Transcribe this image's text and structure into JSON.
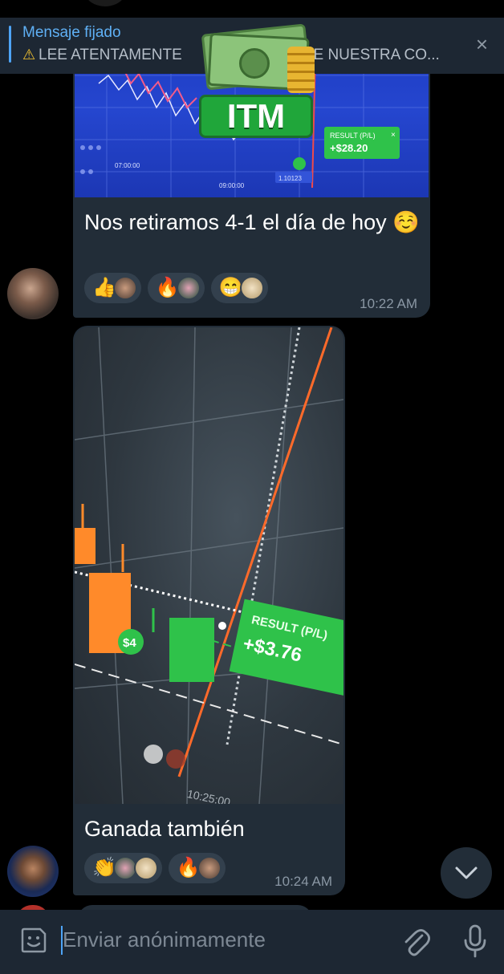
{
  "pinned": {
    "title": "Mensaje fijado",
    "text_left": "LEE ATENTAMENTE",
    "text_right": "DE NUESTRA CO...",
    "close_label": "×"
  },
  "sticker": {
    "label": "ITM"
  },
  "messages": [
    {
      "photo": {
        "result_label": "RESULT (P/L)",
        "result_value": "+$28.20",
        "price_label": "1.10123",
        "time_labels": [
          "07:00:00",
          "09:00:00"
        ]
      },
      "caption": "Nos retiramos 4-1 el día de hoy ☺️",
      "reactions": [
        {
          "emoji": "👍",
          "avatars": 1
        },
        {
          "emoji": "🔥",
          "avatars": 1
        },
        {
          "emoji": "😁",
          "avatars": 1
        }
      ],
      "time": "10:22 AM"
    },
    {
      "photo": {
        "result_label": "RESULT (P/L)",
        "result_value": "+$3.76",
        "stake_label": "$4",
        "time_label": "10:25:00"
      },
      "caption": "Ganada también",
      "reactions": [
        {
          "emoji": "👏",
          "avatars": 2
        },
        {
          "emoji": "🔥",
          "avatars": 1
        }
      ],
      "time": "10:24 AM"
    }
  ],
  "composer": {
    "placeholder": "Enviar anónimamente"
  },
  "colors": {
    "accent": "#4ea4f6",
    "bubble": "#222d38",
    "panel": "#1d2733",
    "success": "#2fc24a"
  }
}
